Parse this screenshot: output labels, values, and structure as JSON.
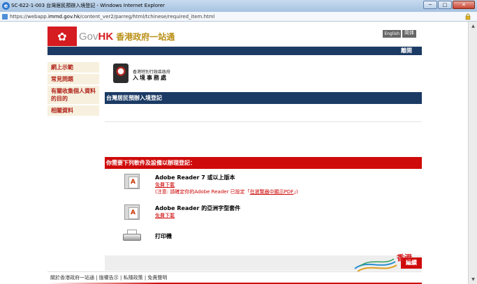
{
  "window": {
    "title": "SC-622-1-003 台灣居民預辦入境登記 - Windows Internet Explorer",
    "url_prefix": "https://webapp.",
    "url_domain": "immd.gov.hk",
    "url_suffix": "/content_ver2/parreg/html/tchinese/required_item.html",
    "minimize": "─",
    "maximize": "□",
    "close": "✕"
  },
  "header": {
    "brand_gov": "Gov",
    "brand_hk": "HK",
    "brand_cn": "香港政府一站通",
    "lang_english": "English",
    "lang_simplified": "简体"
  },
  "navbar": {
    "close_label": "離開"
  },
  "sidebar": {
    "items": [
      {
        "label": "網上示範"
      },
      {
        "label": "常見問題"
      },
      {
        "label": "有關收集個人資料的目的"
      },
      {
        "label": "相關資料"
      }
    ]
  },
  "dept": {
    "name_small": "香港特別行政區政府",
    "name_big": "入境事務處"
  },
  "section_title": "台灣居民預辦入境登記",
  "requirements_title": "你需要下列軟件及設備以辦理登記：",
  "requirements": [
    {
      "label": "Adobe Reader 7 或以上版本",
      "download": "免費下載",
      "note_prefix": "(注意: 請確定你的Adobe Reader 已設定「",
      "note_link": "在瀏覽器中顯示PDF",
      "note_suffix": "」)"
    },
    {
      "label": "Adobe Reader 的亞洲字型套件",
      "download": "免費下載"
    },
    {
      "label": "打印機"
    }
  ],
  "next_button": "繼續",
  "brand_footer": "香港",
  "footer_links": "關於香港政府一站通 | 版權告示 | 私隱政策 | 免責聲明"
}
